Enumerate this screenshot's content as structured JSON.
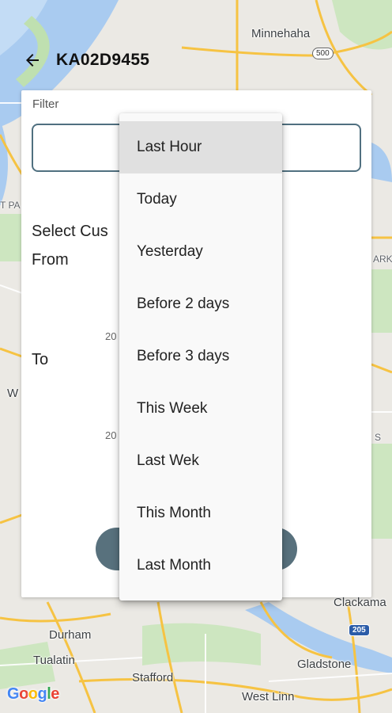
{
  "map": {
    "labels": {
      "minnehaha": "Minnehaha",
      "clackamas": "Clackama",
      "durham": "Durham",
      "tualatin": "Tualatin",
      "stafford": "Stafford",
      "gladstone": "Gladstone",
      "west_linn": "West Linn",
      "park": "ARK",
      "tpa": "T PA",
      "w": "W",
      "s": "S"
    },
    "shields": {
      "route_500": "500",
      "i205": "205"
    },
    "google_letters": [
      "G",
      "o",
      "o",
      "g",
      "l",
      "e"
    ]
  },
  "appbar": {
    "title": "KA02D9455",
    "back_icon": "arrow-back-icon"
  },
  "filter_card": {
    "filter_label": "Filter",
    "filter_value": "",
    "select_custom_label": "Select Cus",
    "from_label": "From",
    "to_label": "To",
    "from_hint": "20",
    "to_hint": "20",
    "apply_label": ""
  },
  "dropdown": {
    "items": [
      {
        "label": "Last Hour",
        "selected": true
      },
      {
        "label": "Today"
      },
      {
        "label": "Yesterday"
      },
      {
        "label": "Before 2 days"
      },
      {
        "label": "Before 3 days"
      },
      {
        "label": "This Week"
      },
      {
        "label": "Last Wek"
      },
      {
        "label": "This Month"
      },
      {
        "label": "Last Month"
      }
    ]
  },
  "colors": {
    "accent": "#58717d",
    "input_border": "#507080",
    "selected_item": "#e0e0e0",
    "map_road_yellow": "#f6c343",
    "map_water": "#a9cbf0",
    "map_green": "#bfe0b0"
  }
}
